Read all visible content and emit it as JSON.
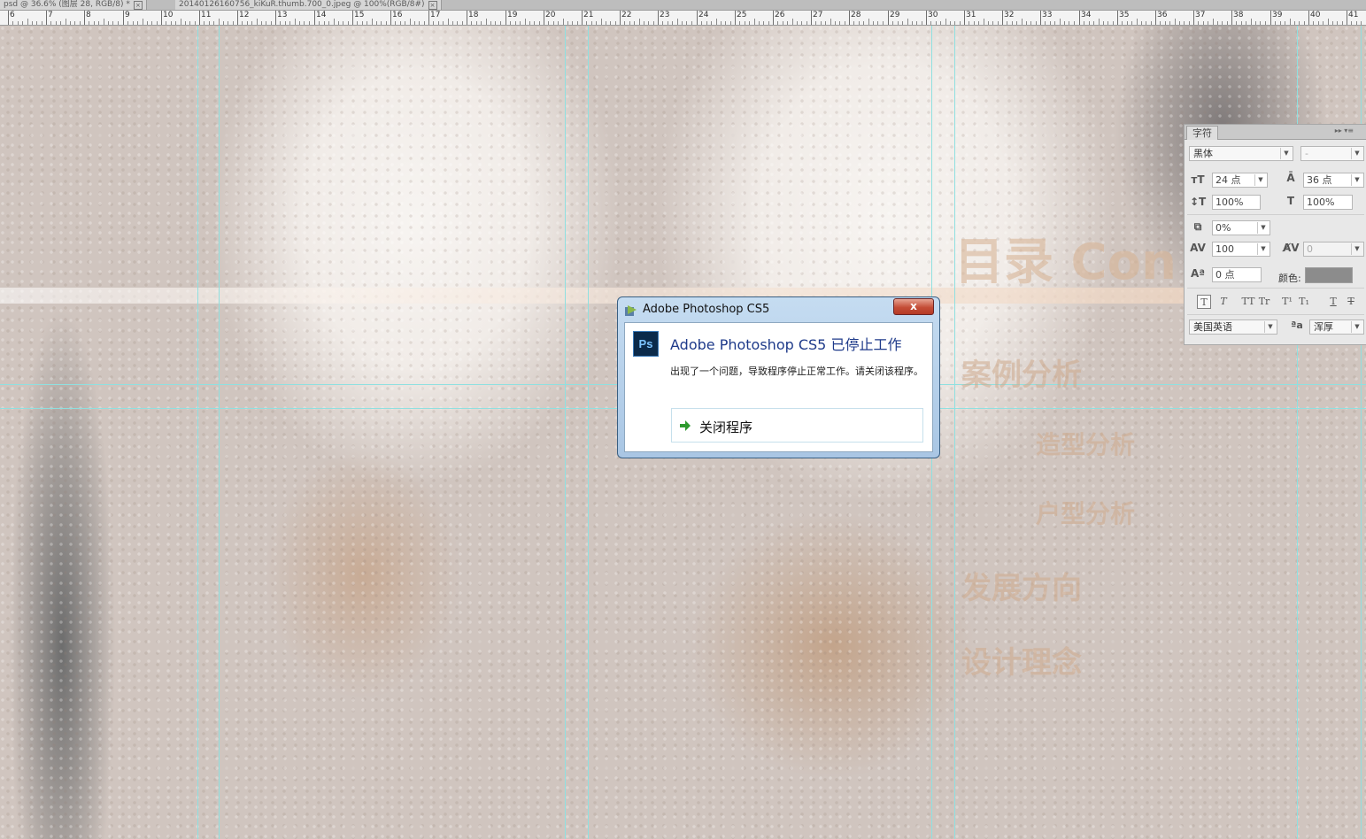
{
  "tabs": [
    {
      "label": "psd @ 36.6% (图层 28, RGB/8) *",
      "close": "×"
    },
    {
      "label": "20140126160756_kiKuR.thumb.700_0.jpeg @ 100%(RGB/8#)",
      "close": "×"
    }
  ],
  "ruler": {
    "labels": [
      "6",
      "7",
      "8",
      "9",
      "10",
      "11",
      "12",
      "13",
      "14",
      "15",
      "16",
      "17",
      "18",
      "19",
      "20",
      "21",
      "22",
      "23",
      "24",
      "25",
      "26",
      "27",
      "28",
      "29",
      "30",
      "31",
      "32",
      "33",
      "34",
      "35",
      "36",
      "37",
      "38",
      "39",
      "40",
      "41"
    ]
  },
  "canvas": {
    "title": "目录 Con",
    "menu": [
      "案例分析",
      "造型分析",
      "户型分析",
      "发展方向",
      "设计理念"
    ]
  },
  "character_panel": {
    "tab": "字符",
    "menu_icons": "▸▸ ▾≡",
    "font_family": "黑体",
    "font_style": "-",
    "font_size": "24 点",
    "leading": "36 点",
    "vertical_scale": "100%",
    "horizontal_scale": "100%",
    "tsume": "0%",
    "tracking": "100",
    "kerning": "0",
    "baseline_shift": "0 点",
    "color_label": "颜色:",
    "color": "#8c8c8c",
    "style_buttons": [
      "T",
      "T",
      "TT",
      "Tr",
      "T¹",
      "T₁",
      "T",
      "T"
    ],
    "language": "美国英语",
    "antialias": "浑厚",
    "antialias_icon": "ªa"
  },
  "dialog": {
    "title": "Adobe Photoshop CS5",
    "close": "x",
    "app_icon": "Ps",
    "heading": "Adobe Photoshop CS5 已停止工作",
    "message": "出现了一个问题，导致程序停止正常工作。请关闭该程序。",
    "action": "关闭程序"
  }
}
